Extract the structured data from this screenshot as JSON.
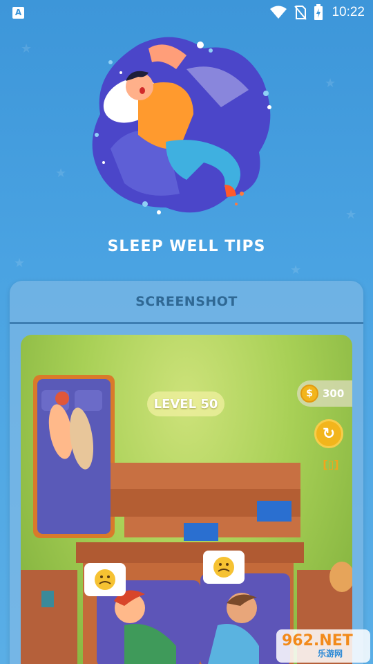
{
  "status_bar": {
    "left_icon": "A",
    "time": "10:22",
    "icons": [
      "wifi-icon",
      "no-sim-icon",
      "battery-charging-icon"
    ]
  },
  "app": {
    "title": "SLEEP WELL TIPS"
  },
  "card": {
    "title": "SCREENSHOT"
  },
  "game": {
    "level": "LEVEL 50",
    "coins": "300",
    "coin_symbol": "$"
  },
  "watermark": {
    "top": "962.NET",
    "bottom": "乐游网"
  },
  "colors": {
    "background": "#3d96d9",
    "card_border": "#2f6fa3",
    "coin": "#f2b51c",
    "title_text": "#ffffff"
  }
}
